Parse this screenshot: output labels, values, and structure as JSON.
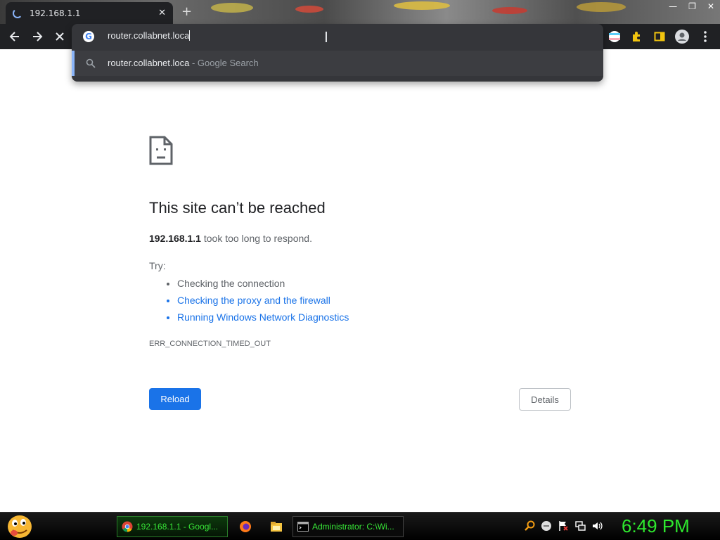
{
  "tab": {
    "title": "192.168.1.1"
  },
  "omnibox": {
    "input_value": "router.collabnet.loca",
    "suggestion_text": "router.collabnet.loca",
    "suggestion_separator": " - ",
    "suggestion_source": "Google Search"
  },
  "error": {
    "title": "This site can’t be reached",
    "host": "192.168.1.1",
    "message": " took too long to respond.",
    "try_label": "Try:",
    "suggestions": [
      "Checking the connection",
      "Checking the proxy and the firewall",
      "Running Windows Network Diagnostics"
    ],
    "code": "ERR_CONNECTION_TIMED_OUT",
    "reload_label": "Reload",
    "details_label": "Details"
  },
  "taskbar": {
    "items": [
      {
        "label": "192.168.1.1 - Googl...",
        "icon": "chrome-icon"
      },
      {
        "label": "Administrator: C:\\Wi...",
        "icon": "cmd-icon"
      }
    ],
    "clock": "6:49 PM"
  },
  "colors": {
    "accent": "#1a73e8",
    "toolbar": "#202124",
    "taskbar_text": "#37e737"
  }
}
